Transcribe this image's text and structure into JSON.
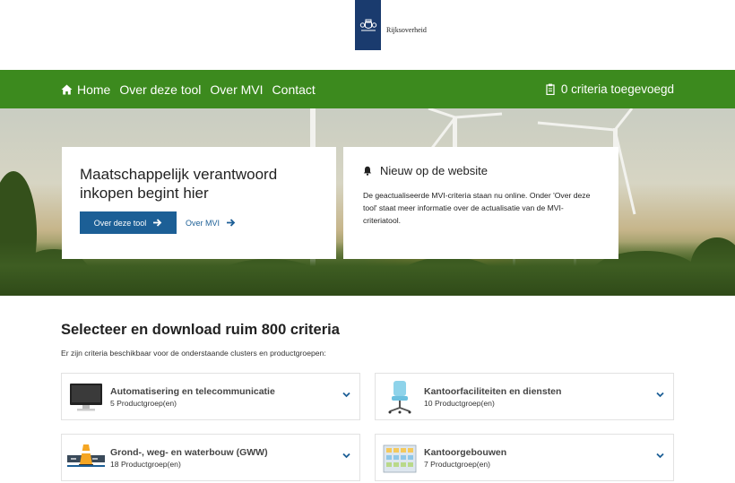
{
  "header": {
    "logo_text": "Rijksoverheid"
  },
  "nav": {
    "items": [
      {
        "label": "Home",
        "icon": "home-icon"
      },
      {
        "label": "Over deze tool"
      },
      {
        "label": "Over MVI"
      },
      {
        "label": "Contact"
      }
    ],
    "criteria_count": "0 criteria toegevoegd"
  },
  "hero": {
    "title": "Maatschappelijk verantwoord inkopen begint hier",
    "primary_button": "Over deze tool",
    "secondary_link": "Over MVI",
    "news_title": "Nieuw op de website",
    "news_body": "De geactualiseerde MVI-criteria staan nu online. Onder 'Over deze tool' staat meer informatie over de actualisatie van de MVI-criteriatool."
  },
  "section": {
    "title": "Selecteer en download ruim 800 criteria",
    "subtitle": "Er zijn criteria beschikbaar voor de onderstaande clusters en productgroepen:"
  },
  "clusters": [
    {
      "name": "Automatisering en telecommunicatie",
      "count": "5 Productgroep(en)",
      "icon": "monitor-icon"
    },
    {
      "name": "Kantoorfaciliteiten en diensten",
      "count": "10 Productgroep(en)",
      "icon": "office-chair-icon"
    },
    {
      "name": "Grond-, weg- en waterbouw (GWW)",
      "count": "18 Productgroep(en)",
      "icon": "road-works-icon"
    },
    {
      "name": "Kantoorgebouwen",
      "count": "7 Productgroep(en)",
      "icon": "office-building-icon"
    }
  ],
  "colors": {
    "nav_green": "#3c8a1e",
    "primary_blue": "#1c5f96",
    "logo_blue": "#1a3b6e"
  }
}
